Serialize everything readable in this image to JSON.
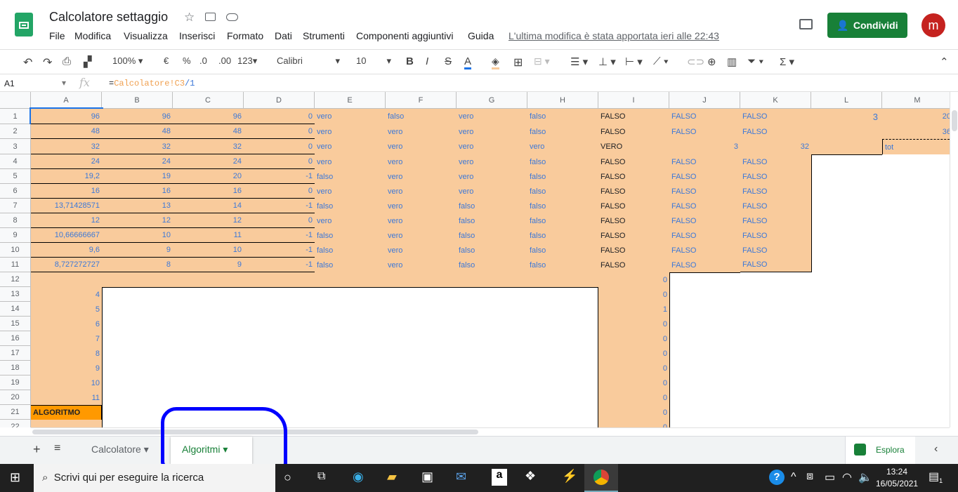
{
  "app": {
    "title": "Calcolatore settaggio",
    "last_modified": "L'ultima modifica è stata apportata ieri alle 22:43",
    "share_label": "Condividi",
    "avatar_letter": "m"
  },
  "menu": [
    "File",
    "Modifica",
    "Visualizza",
    "Inserisci",
    "Formato",
    "Dati",
    "Strumenti",
    "Componenti aggiuntivi",
    "Guida"
  ],
  "toolbar": {
    "zoom": "100%",
    "currency": "€",
    "percent": "%",
    "dec_less": ".0",
    "dec_more": ".00",
    "format": "123",
    "font": "Calibri",
    "size": "10"
  },
  "formula_bar": {
    "cell_ref": "A1",
    "formula_prefix": "=",
    "formula_ref": "Calcolatore!C3",
    "formula_suffix": "/1"
  },
  "columns": [
    "A",
    "B",
    "C",
    "D",
    "E",
    "F",
    "G",
    "H",
    "I",
    "J",
    "K",
    "L",
    "M"
  ],
  "rows": [
    [
      "96",
      "96",
      "96",
      "0",
      "vero",
      "falso",
      "vero",
      "falso",
      "FALSO",
      "FALSO",
      "FALSO",
      "3",
      "20"
    ],
    [
      "48",
      "48",
      "48",
      "0",
      "vero",
      "vero",
      "vero",
      "falso",
      "FALSO",
      "FALSO",
      "FALSO",
      "",
      "36"
    ],
    [
      "32",
      "32",
      "32",
      "0",
      "vero",
      "vero",
      "vero",
      "vero",
      "VERO",
      "3",
      "32",
      "",
      "tot"
    ],
    [
      "24",
      "24",
      "24",
      "0",
      "vero",
      "vero",
      "vero",
      "falso",
      "FALSO",
      "FALSO",
      "FALSO",
      "",
      ""
    ],
    [
      "19,2",
      "19",
      "20",
      "-1",
      "falso",
      "vero",
      "vero",
      "falso",
      "FALSO",
      "FALSO",
      "FALSO",
      "",
      ""
    ],
    [
      "16",
      "16",
      "16",
      "0",
      "vero",
      "vero",
      "vero",
      "falso",
      "FALSO",
      "FALSO",
      "FALSO",
      "",
      ""
    ],
    [
      "13,71428571",
      "13",
      "14",
      "-1",
      "falso",
      "vero",
      "falso",
      "falso",
      "FALSO",
      "FALSO",
      "FALSO",
      "",
      ""
    ],
    [
      "12",
      "12",
      "12",
      "0",
      "vero",
      "vero",
      "falso",
      "falso",
      "FALSO",
      "FALSO",
      "FALSO",
      "",
      ""
    ],
    [
      "10,66666667",
      "10",
      "11",
      "-1",
      "falso",
      "vero",
      "falso",
      "falso",
      "FALSO",
      "FALSO",
      "FALSO",
      "",
      ""
    ],
    [
      "9,6",
      "9",
      "10",
      "-1",
      "falso",
      "vero",
      "falso",
      "falso",
      "FALSO",
      "FALSO",
      "FALSO",
      "",
      ""
    ],
    [
      "8,727272727",
      "8",
      "9",
      "-1",
      "falso",
      "vero",
      "falso",
      "falso",
      "FALSO",
      "FALSO",
      "FALSO",
      "",
      ""
    ],
    [
      "",
      "",
      "",
      "",
      "",
      "",
      "",
      "",
      "0",
      "",
      "",
      "",
      ""
    ],
    [
      "4",
      "",
      "",
      "",
      "",
      "",
      "",
      "",
      "0",
      "",
      "",
      "",
      ""
    ],
    [
      "5",
      "",
      "",
      "",
      "",
      "",
      "",
      "",
      "1",
      "",
      "",
      "",
      ""
    ],
    [
      "6",
      "",
      "",
      "",
      "",
      "",
      "",
      "",
      "0",
      "",
      "",
      "",
      ""
    ],
    [
      "7",
      "",
      "",
      "",
      "",
      "",
      "",
      "",
      "0",
      "",
      "",
      "",
      ""
    ],
    [
      "8",
      "",
      "",
      "",
      "",
      "",
      "",
      "",
      "0",
      "",
      "",
      "",
      ""
    ],
    [
      "9",
      "",
      "",
      "",
      "",
      "",
      "",
      "",
      "0",
      "",
      "",
      "",
      ""
    ],
    [
      "10",
      "",
      "",
      "",
      "",
      "",
      "",
      "",
      "0",
      "",
      "",
      "",
      ""
    ],
    [
      "11",
      "",
      "",
      "",
      "",
      "",
      "",
      "",
      "0",
      "",
      "",
      "",
      ""
    ],
    [
      "ALGORITMO",
      "",
      "",
      "",
      "",
      "",
      "",
      "",
      "0",
      "",
      "",
      "",
      ""
    ],
    [
      "",
      "",
      "",
      "",
      "",
      "",
      "",
      "",
      "0",
      "",
      "",
      "",
      ""
    ]
  ],
  "colors": {
    "fill": "#f9cb9c",
    "dark_fill": "#ff9900",
    "text": "#3c78d8",
    "share": "#188038",
    "annotation": "#0000ff"
  },
  "sheets": {
    "tabs": [
      "Calcolatore",
      "Algoritmi"
    ],
    "active": "Algoritmi",
    "explore": "Esplora"
  },
  "taskbar": {
    "search_placeholder": "Scrivi qui per eseguire la ricerca",
    "time": "13:24",
    "date": "16/05/2021",
    "notifications": "1"
  }
}
